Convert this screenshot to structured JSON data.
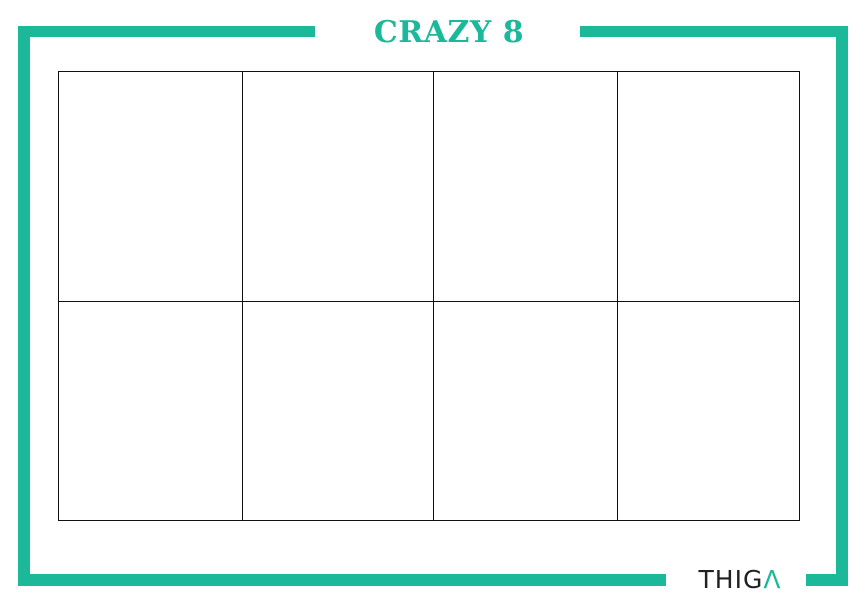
{
  "title": "CRAZY 8",
  "logo": {
    "text": "THIGΛ"
  },
  "colors": {
    "frame": "#1bb899",
    "title": "#1bb899",
    "grid_lines": "#111111",
    "logo_text": "#222222",
    "logo_accent": "#1bb899"
  },
  "grid": {
    "rows": 2,
    "columns": 4,
    "panels": 8
  }
}
